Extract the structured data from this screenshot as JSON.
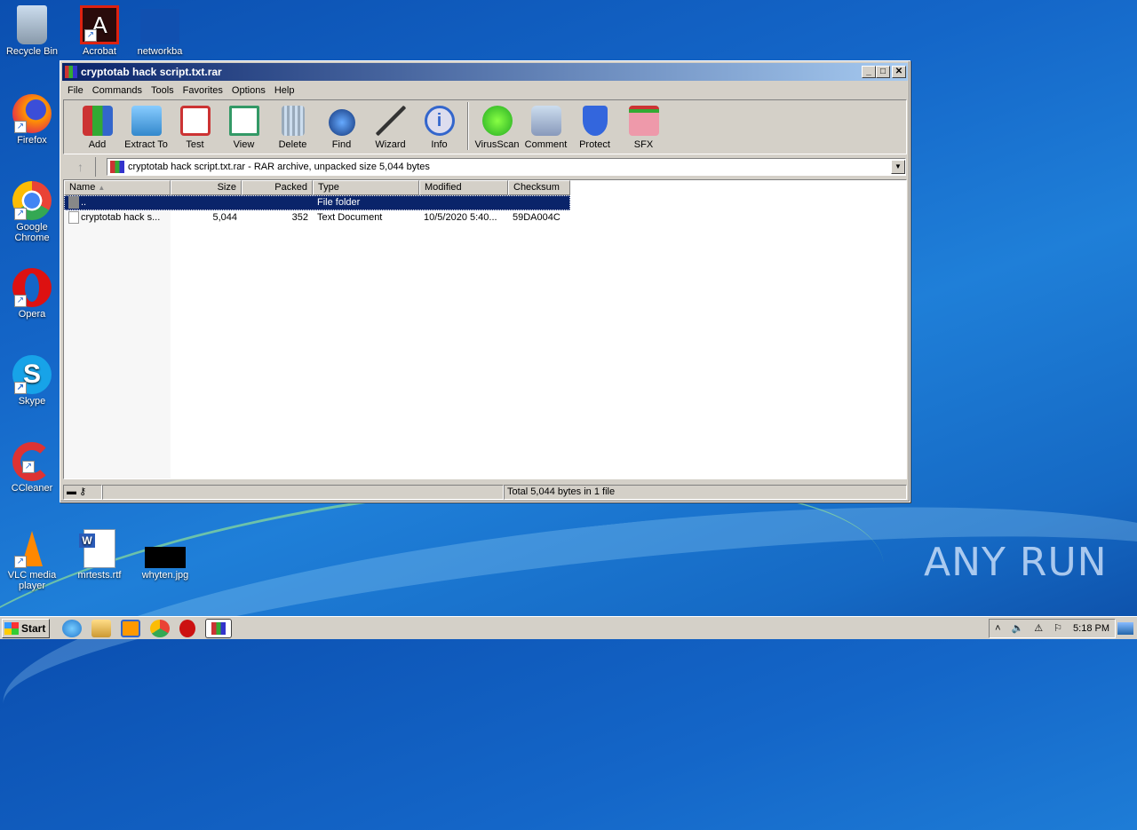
{
  "desktop": {
    "icons": [
      {
        "label": "Recycle Bin",
        "name": "recycle-bin"
      },
      {
        "label": "Acrobat",
        "name": "acrobat"
      },
      {
        "label": "networkba",
        "name": "networkba"
      },
      {
        "label": "Firefox",
        "name": "firefox"
      },
      {
        "label": "Google Chrome",
        "name": "google-chrome"
      },
      {
        "label": "Opera",
        "name": "opera"
      },
      {
        "label": "Skype",
        "name": "skype"
      },
      {
        "label": "CCleaner",
        "name": "ccleaner"
      },
      {
        "label": "VLC media player",
        "name": "vlc"
      },
      {
        "label": "mrtests.rtf",
        "name": "mrtests-rtf"
      },
      {
        "label": "whyten.jpg",
        "name": "whyten-jpg"
      }
    ],
    "watermark": "ANY RUN"
  },
  "window": {
    "title": "cryptotab hack script.txt.rar",
    "controls": {
      "minimize": "_",
      "maximize": "□",
      "close": "✕"
    },
    "menu": [
      "File",
      "Commands",
      "Tools",
      "Favorites",
      "Options",
      "Help"
    ],
    "toolbar": [
      "Add",
      "Extract To",
      "Test",
      "View",
      "Delete",
      "Find",
      "Wizard",
      "Info",
      "VirusScan",
      "Comment",
      "Protect",
      "SFX"
    ],
    "address": "cryptotab hack script.txt.rar - RAR archive, unpacked size 5,044 bytes",
    "columns": [
      "Name",
      "Size",
      "Packed",
      "Type",
      "Modified",
      "Checksum"
    ],
    "rows": [
      {
        "name": "..",
        "size": "",
        "packed": "",
        "type": "File folder",
        "modified": "",
        "checksum": "",
        "selected": true
      },
      {
        "name": "cryptotab hack s...",
        "size": "5,044",
        "packed": "352",
        "type": "Text Document",
        "modified": "10/5/2020 5:40...",
        "checksum": "59DA004C",
        "selected": false
      }
    ],
    "status": "Total 5,044 bytes in 1 file"
  },
  "taskbar": {
    "start": "Start",
    "clock": "5:18 PM"
  }
}
